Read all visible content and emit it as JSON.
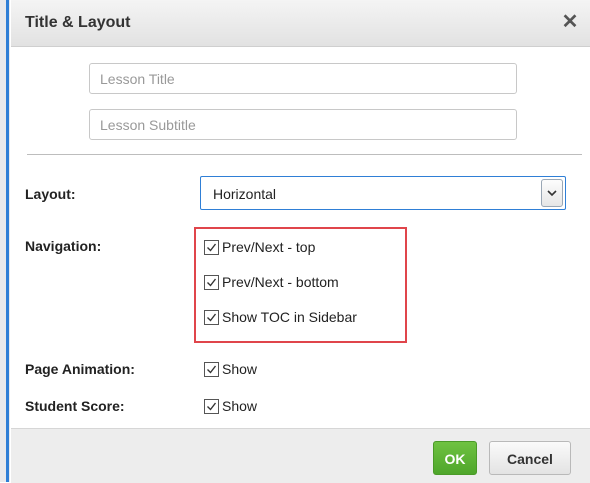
{
  "dialog": {
    "title": "Title & Layout",
    "close_glyph": "✕"
  },
  "fields": {
    "lesson_title": {
      "value": "",
      "placeholder": "Lesson Title"
    },
    "lesson_subtitle": {
      "value": "",
      "placeholder": "Lesson Subtitle"
    }
  },
  "layout": {
    "label": "Layout:",
    "selected": "Horizontal"
  },
  "navigation": {
    "label": "Navigation:",
    "options": [
      {
        "label": "Prev/Next - top",
        "checked": true
      },
      {
        "label": "Prev/Next - bottom",
        "checked": true
      },
      {
        "label": "Show TOC in Sidebar",
        "checked": true
      }
    ]
  },
  "page_animation": {
    "label": "Page Animation:",
    "option_label": "Show",
    "checked": true
  },
  "student_score": {
    "label": "Student Score:",
    "option_label": "Show",
    "checked": true
  },
  "footer": {
    "ok_label": "OK",
    "cancel_label": "Cancel"
  },
  "colors": {
    "ok_green": "#5cb531",
    "highlight_red": "#e0454b",
    "focus_blue": "#2f7fd6"
  },
  "icons": {
    "close": "close-icon",
    "dropdown": "chevron-down-icon",
    "check": "checkmark-icon"
  }
}
